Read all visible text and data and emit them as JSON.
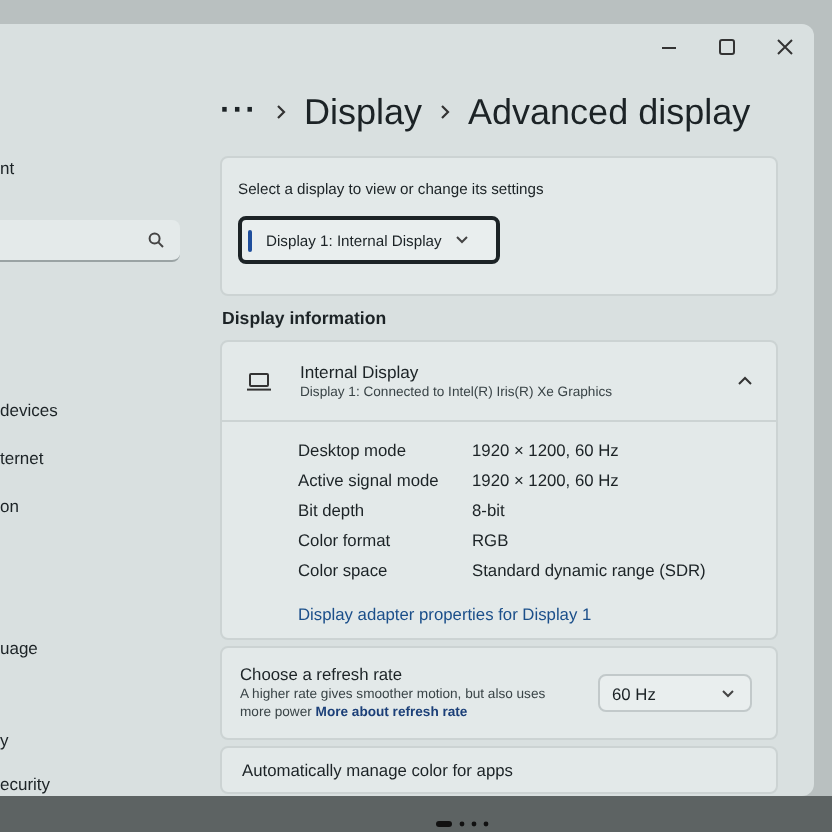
{
  "sidebar": {
    "items": [
      {
        "kind": "text",
        "label": "nt"
      },
      {
        "kind": "search"
      },
      {
        "kind": "text",
        "label": "devices"
      },
      {
        "kind": "text",
        "label": "ternet"
      },
      {
        "kind": "text",
        "label": "on"
      },
      {
        "kind": "text",
        "label": "uage"
      },
      {
        "kind": "text",
        "label": "y"
      },
      {
        "kind": "text",
        "label": "ecurity"
      }
    ]
  },
  "breadcrumb": {
    "more": "···",
    "items": [
      "Display",
      "Advanced display"
    ]
  },
  "display_select": {
    "label": "Select a display to view or change its settings",
    "value": "Display 1: Internal Display"
  },
  "display_information": {
    "heading": "Display information",
    "title": "Internal Display",
    "subtitle": "Display 1: Connected to Intel(R) Iris(R) Xe Graphics",
    "expanded": true,
    "rows": [
      {
        "label": "Desktop mode",
        "value": "1920 × 1200, 60 Hz"
      },
      {
        "label": "Active signal mode",
        "value": "1920 × 1200, 60 Hz"
      },
      {
        "label": "Bit depth",
        "value": "8-bit"
      },
      {
        "label": "Color format",
        "value": "RGB"
      },
      {
        "label": "Color space",
        "value": "Standard dynamic range (SDR)"
      }
    ],
    "link": "Display adapter properties for Display 1"
  },
  "refresh_rate": {
    "title": "Choose a refresh rate",
    "description": "A higher rate gives smoother motion, but also uses more power",
    "link": "More about refresh rate",
    "value": "60 Hz"
  },
  "auto_color": {
    "title": "Automatically manage color for apps"
  }
}
